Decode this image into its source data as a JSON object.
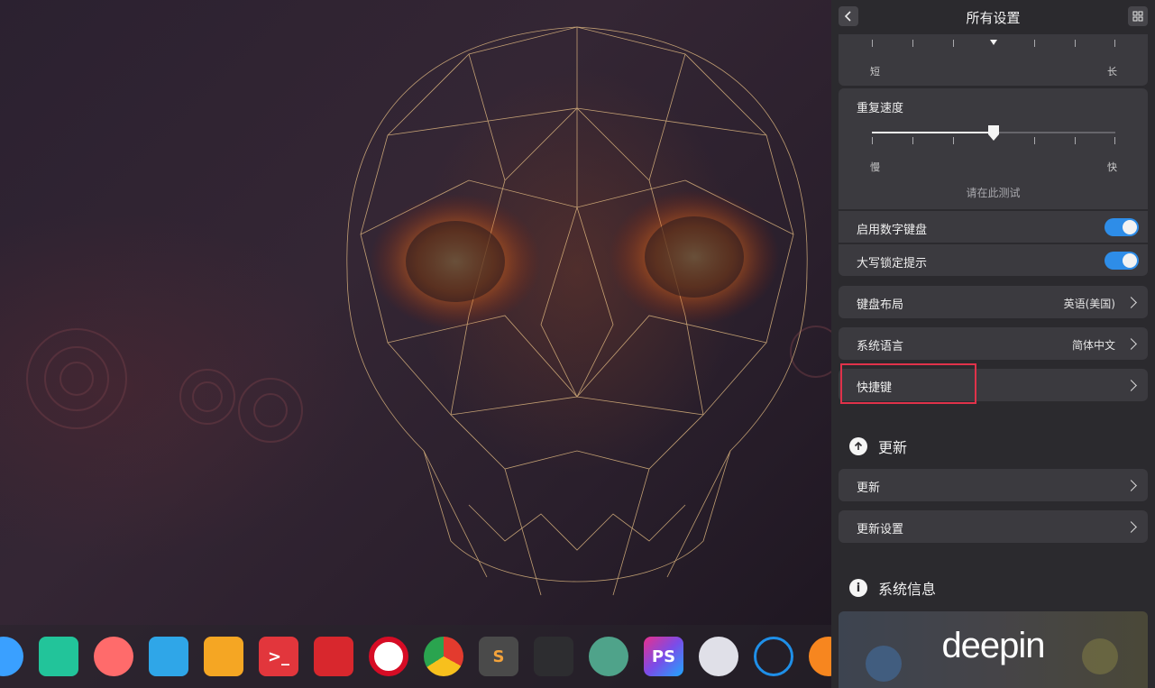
{
  "panel": {
    "title": "所有设置",
    "back_icon": "chevron-left-icon",
    "grid_icon": "grid-icon"
  },
  "keyboard": {
    "delay_slider": {
      "min_label": "短",
      "max_label": "长",
      "value_fraction": 0.5
    },
    "repeat_speed": {
      "label": "重复速度",
      "min_label": "慢",
      "max_label": "快",
      "value_fraction": 0.5,
      "test_placeholder": "请在此测试"
    },
    "numlock": {
      "label": "启用数字键盘",
      "enabled": true
    },
    "capslock_hint": {
      "label": "大写锁定提示",
      "enabled": true
    },
    "layout": {
      "label": "键盘布局",
      "value": "英语(美国)"
    },
    "language": {
      "label": "系统语言",
      "value": "简体中文"
    },
    "shortcuts": {
      "label": "快捷键"
    }
  },
  "update": {
    "section_title": "更新",
    "section_icon": "arrow-up-icon",
    "items": [
      {
        "label": "更新"
      },
      {
        "label": "更新设置"
      }
    ]
  },
  "sysinfo": {
    "section_title": "系统信息",
    "section_icon": "info-icon",
    "logo_text": "deepin"
  },
  "dock": {
    "apps": [
      {
        "name": "launcher",
        "color": "#3aa0ff"
      },
      {
        "name": "deepin-file-manager",
        "color": "#22c49a"
      },
      {
        "name": "screen-recorder",
        "color": "#ff6b6b"
      },
      {
        "name": "archive-manager",
        "color": "#2fa6e8"
      },
      {
        "name": "app-store",
        "color": "#f5a623"
      },
      {
        "name": "terminal",
        "color": "#e2363c"
      },
      {
        "name": "netease-music",
        "color": "#d8272d"
      },
      {
        "name": "opera",
        "color": "#d60c25"
      },
      {
        "name": "chrome",
        "color": "#e8e8e8"
      },
      {
        "name": "sublime-text",
        "color": "#4a4a4a"
      },
      {
        "name": "visual-studio",
        "color": "#2d2d30"
      },
      {
        "name": "atom",
        "color": "#4fa38a"
      },
      {
        "name": "phpstorm",
        "color": "#7b4ce8"
      },
      {
        "name": "settings",
        "color": "#e0e0e8"
      },
      {
        "name": "input-method",
        "color": "#1f8fe8"
      },
      {
        "name": "eject",
        "color": "#f7861f"
      }
    ]
  }
}
